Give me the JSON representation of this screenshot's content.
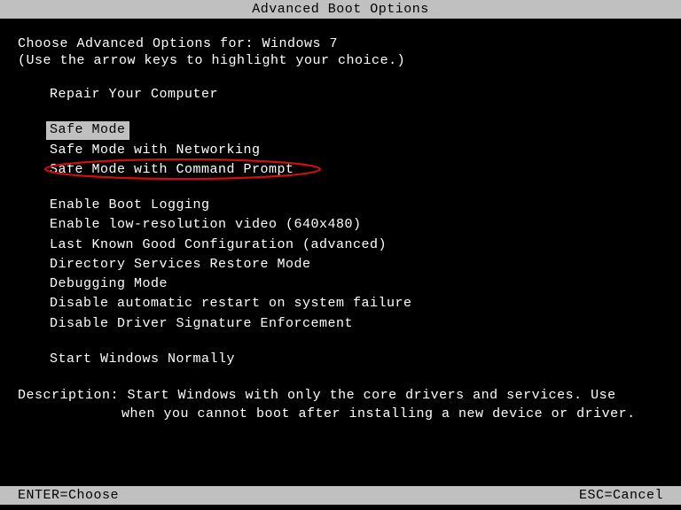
{
  "title": "Advanced Boot Options",
  "header": "Choose Advanced Options for: Windows 7",
  "instruction": "(Use the arrow keys to highlight your choice.)",
  "menu": {
    "repair": "Repair Your Computer",
    "safe_mode": "Safe Mode",
    "safe_mode_net": "Safe Mode with Networking",
    "safe_mode_cmd": "Safe Mode with Command Prompt",
    "boot_logging": "Enable Boot Logging",
    "low_res": "Enable low-resolution video (640x480)",
    "last_known": "Last Known Good Configuration (advanced)",
    "ds_restore": "Directory Services Restore Mode",
    "debugging": "Debugging Mode",
    "disable_restart": "Disable automatic restart on system failure",
    "disable_sig": "Disable Driver Signature Enforcement",
    "start_normal": "Start Windows Normally"
  },
  "description": {
    "label": "Description: ",
    "line1": "Start Windows with only the core drivers and services. Use",
    "line2": "when you cannot boot after installing a new device or driver."
  },
  "footer": {
    "enter": "ENTER=Choose",
    "esc": "ESC=Cancel"
  }
}
